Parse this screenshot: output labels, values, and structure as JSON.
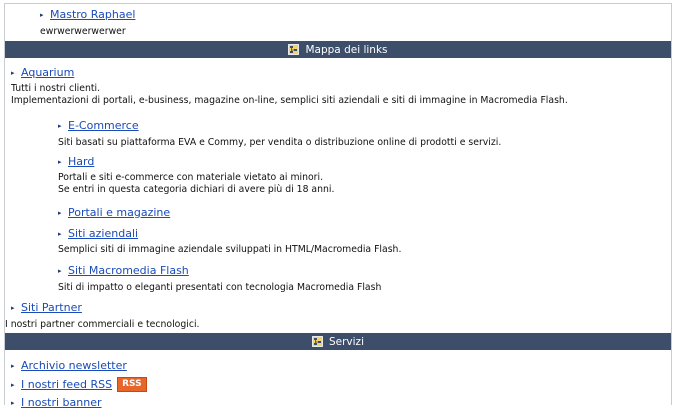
{
  "top": {
    "link": "Mastro Raphael",
    "desc": "ewrwerwerwerwer"
  },
  "links_section": {
    "title": "Mappa dei links",
    "items": [
      {
        "label": "Aquarium",
        "desc": [
          "Tutti i nostri clienti.",
          "Implementazioni di portali, e-business, magazine on-line, semplici siti aziendali e siti di immagine in Macromedia Flash."
        ]
      },
      {
        "label": "E-Commerce",
        "desc": [
          "Siti basati su piattaforma EVA e Commy, per vendita o distribuzione online di prodotti e servizi."
        ]
      },
      {
        "label": "Hard",
        "desc": [
          "Portali e siti e-commerce con materiale vietato ai minori.",
          "Se entri in questa categoria dichiari di avere più di 18 anni."
        ]
      },
      {
        "label": "Portali e magazine",
        "desc": []
      },
      {
        "label": "Siti aziendali",
        "desc": [
          "Semplici siti di immagine aziendale sviluppati in HTML/Macromedia Flash."
        ]
      },
      {
        "label": "Siti Macromedia Flash",
        "desc": [
          "Siti di impatto o eleganti presentati con tecnologia Macromedia Flash"
        ]
      },
      {
        "label": "Siti Partner",
        "desc": [
          "I nostri partner commerciali e tecnologici."
        ]
      }
    ]
  },
  "services_section": {
    "title": "Servizi",
    "items": [
      {
        "label": "Archivio newsletter"
      },
      {
        "label": "I nostri feed RSS",
        "badge": "RSS"
      },
      {
        "label": "I nostri banner"
      }
    ]
  },
  "colors": {
    "section_bar": "#3d4e6b",
    "link": "#1a4bb8",
    "rss_badge": "#e8662a"
  },
  "icons": {
    "bullet": "triangle-bullet-icon",
    "section": "sitemap-icon"
  }
}
